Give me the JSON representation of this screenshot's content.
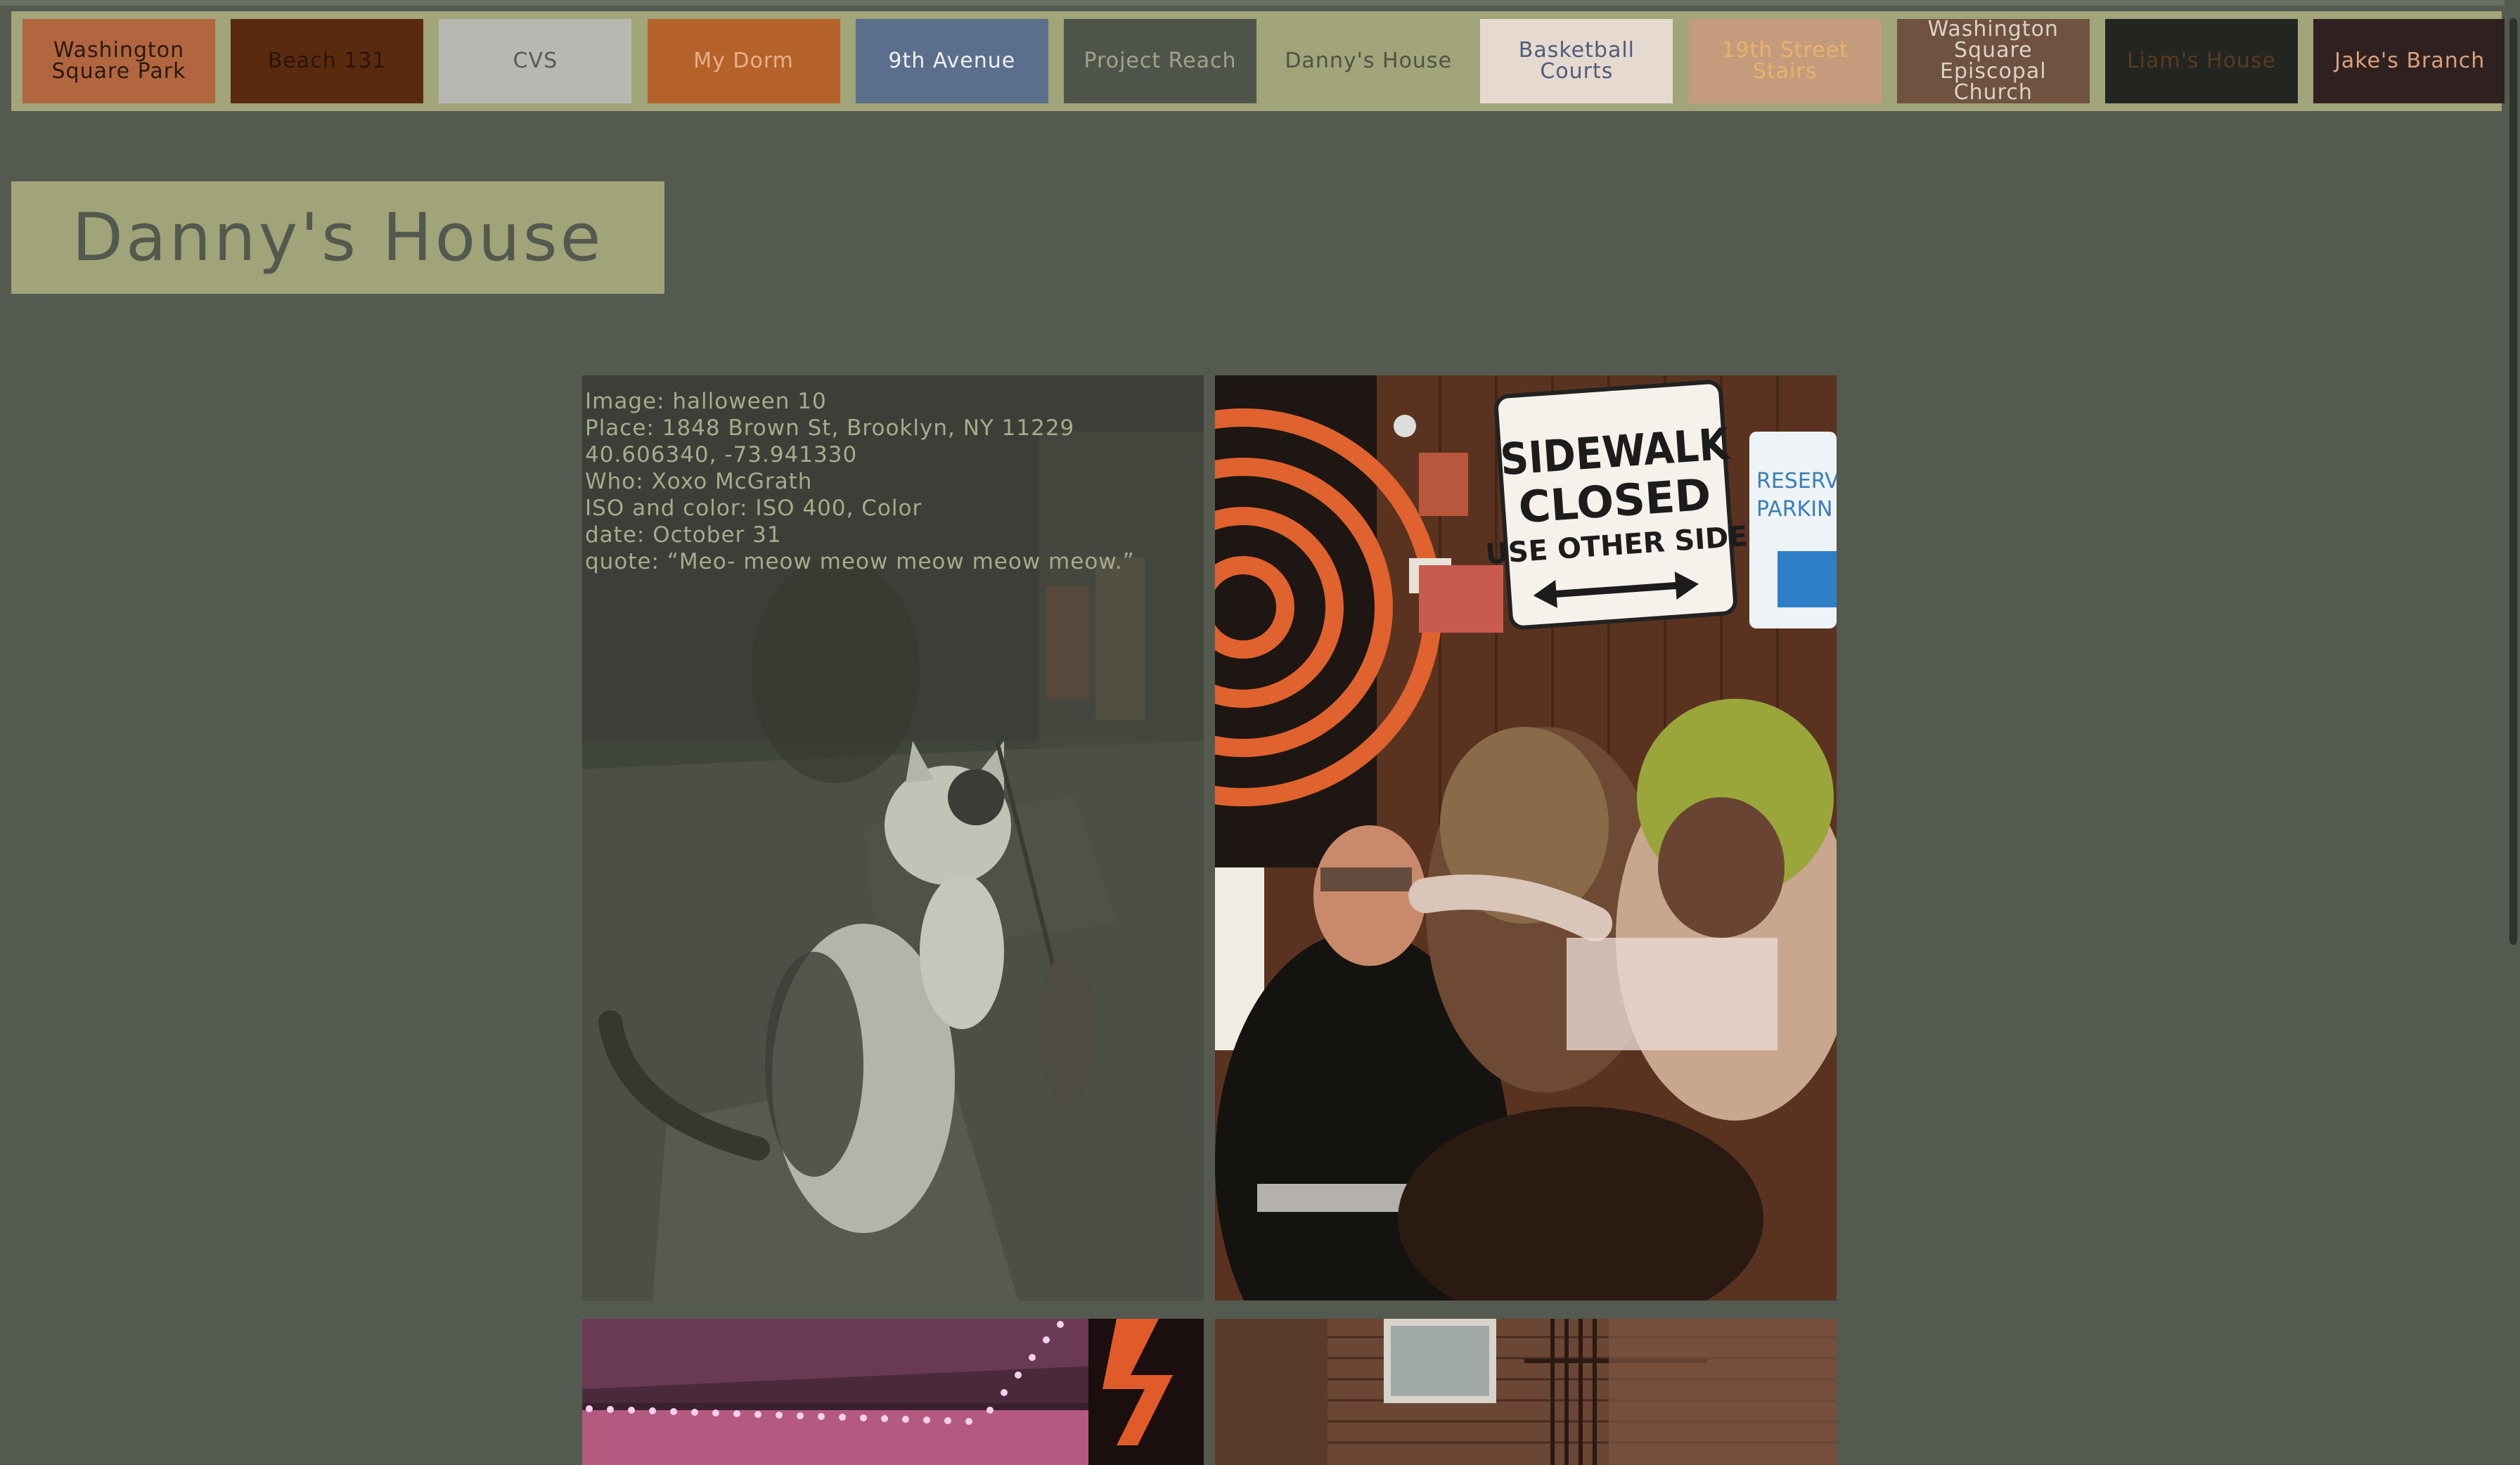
{
  "nav": {
    "items": [
      {
        "label": "Washington Square Park",
        "bg": "#b2663f",
        "fg": "#2a1a10"
      },
      {
        "label": "Beach 131",
        "bg": "#5a2a0f",
        "fg": "#2a1408"
      },
      {
        "label": "CVS",
        "bg": "#b8b8b2",
        "fg": "#5a5a52"
      },
      {
        "label": "My Dorm",
        "bg": "#b5622a",
        "fg": "#e6b08a"
      },
      {
        "label": "9th Avenue",
        "bg": "#5b6f8c",
        "fg": "#eef0f4"
      },
      {
        "label": "Project Reach",
        "bg": "#4f544a",
        "fg": "#a0a28a"
      },
      {
        "label": "Danny's House",
        "bg": "#a2a479",
        "fg": "#4e5348"
      },
      {
        "label": "Basketball Courts",
        "bg": "#e6dad0",
        "fg": "#4d5d7a"
      },
      {
        "label": "19th Street Stairs",
        "bg": "#c49c7d",
        "fg": "#e8b26a"
      },
      {
        "label": "Washington Square Episcopal Church",
        "bg": "#6f5240",
        "fg": "#ddd2c6"
      },
      {
        "label": "Liam's House",
        "bg": "#232520",
        "fg": "#5b3a22"
      },
      {
        "label": "Jake's Branch",
        "bg": "#2f2120",
        "fg": "#dca07a"
      }
    ]
  },
  "page": {
    "title": "Danny's House"
  },
  "photo1": {
    "caption": {
      "image": "Image: halloween 10",
      "place": "Place: 1848 Brown St, Brooklyn, NY 11229 40.606340, -73.941330",
      "who": "Who: Xoxo McGrath",
      "iso": "ISO and color: ISO 400, Color",
      "date": "date: October 31",
      "quote": "quote: “Meo- meow meow meow meow meow.”"
    }
  },
  "photo2": {
    "sign_line1": "SIDEWALK",
    "sign_line2": "CLOSED",
    "sign_line3": "USE OTHER SIDE",
    "sign2_line1": "RESERV",
    "sign2_line2": "PARKIN"
  }
}
